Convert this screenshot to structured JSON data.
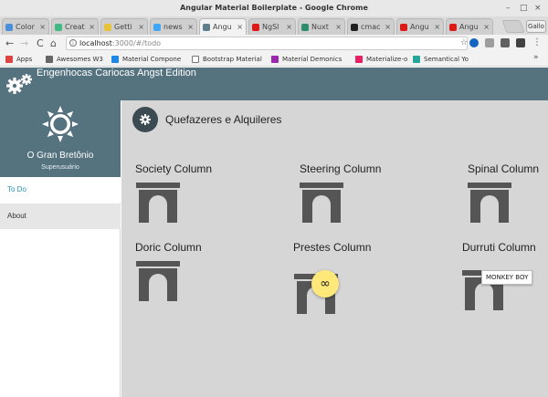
{
  "window": {
    "title": "Angular Material Boilerplate - Google Chrome",
    "minimize": "–",
    "maximize": "□",
    "close": "×"
  },
  "tabs": [
    {
      "label": "Color",
      "color": "#4a90d9"
    },
    {
      "label": "Creat",
      "color": "#42b883"
    },
    {
      "label": "Getti",
      "color": "#e8c23a"
    },
    {
      "label": "news",
      "color": "#42a5f5"
    },
    {
      "label": "Angu",
      "color": "#607d8b",
      "active": true
    },
    {
      "label": "NgSl",
      "color": "#dd1b16"
    },
    {
      "label": "Nuxt",
      "color": "#2d8b6e"
    },
    {
      "label": "cmac",
      "color": "#222222"
    },
    {
      "label": "Angu",
      "color": "#dd1b16"
    },
    {
      "label": "Angu",
      "color": "#dd1b16"
    }
  ],
  "profile_label": "Gallo",
  "tab_close": "×",
  "toolbar": {
    "back": "←",
    "forward": "→",
    "reload": "C",
    "home": "⌂"
  },
  "address": {
    "host": "localhost",
    "path": ":3000/#/todo",
    "info": "i",
    "star": "☆"
  },
  "bookmarks": [
    {
      "label": "Apps",
      "color": "#d44"
    },
    {
      "label": "Awesomes W3",
      "color": "#666"
    },
    {
      "label": "Material Compone",
      "color": "#1e88e5"
    },
    {
      "label": "Bootstrap Material",
      "color": "#ffffff"
    },
    {
      "label": "Material Demonics",
      "color": "#9c27b0"
    },
    {
      "label": "Materialize-o",
      "color": "#e91e63"
    },
    {
      "label": "Semantical Yo",
      "color": "#26a69a"
    }
  ],
  "bookmarks_more": "»",
  "app": {
    "title": "Engenhocas Cariocas Angst Edition",
    "accent": "#55727f"
  },
  "user": {
    "name": "O Gran Bretônio",
    "role": "Superusuário"
  },
  "nav": [
    {
      "label": "To Do",
      "selected": true
    },
    {
      "label": "About",
      "selected": false
    }
  ],
  "page": {
    "title": "Quefazeres e Alquileres"
  },
  "columns": [
    {
      "label": "Society Column"
    },
    {
      "label": "Steering Column"
    },
    {
      "label": "Spinal Column"
    },
    {
      "label": "Doric Column"
    },
    {
      "label": "Prestes Column"
    },
    {
      "label": "Durruti Column"
    }
  ],
  "fab": {
    "symbol": "∞",
    "color": "#ffe87a"
  },
  "tooltip": {
    "text": "MONKEY BOY"
  }
}
